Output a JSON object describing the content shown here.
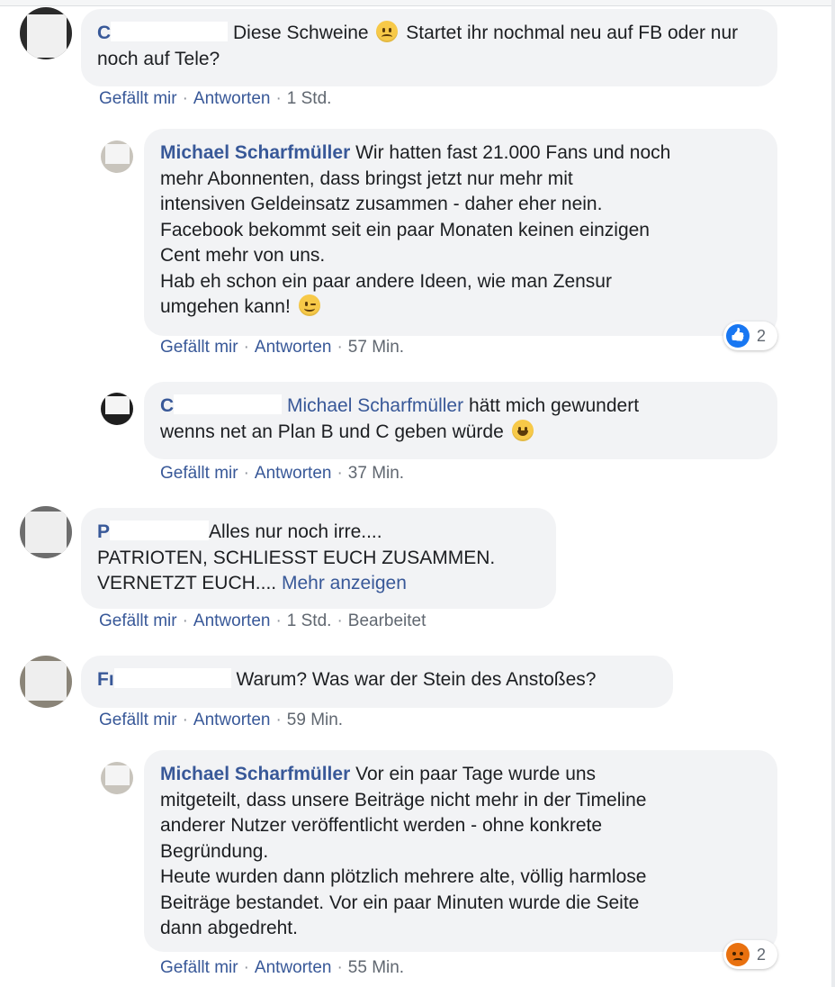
{
  "comments": [
    {
      "author_visible": "C",
      "text_parts": [
        "Diese Schweine",
        "Startet ihr nochmal neu auf FB oder nur noch auf Tele?"
      ],
      "emoji": "angry-face",
      "actions": {
        "like": "Gefällt mir",
        "reply": "Antworten",
        "time": "1 Std."
      }
    },
    {
      "author": "Michael Scharfmüller",
      "text_lines": [
        "Wir hatten fast 21.000 Fans und noch",
        "mehr Abonnenten, dass bringst jetzt nur mehr mit",
        "intensiven Geldeinsatz zusammen - daher eher nein.",
        "Facebook bekommt seit ein paar Monaten keinen einzigen",
        "Cent mehr von uns.",
        "Hab eh schon ein paar andere Ideen, wie man Zensur",
        "umgehen kann!"
      ],
      "emoji": "winking-face",
      "reaction": {
        "icon": "like-icon",
        "count": "2"
      },
      "actions": {
        "like": "Gefällt mir",
        "reply": "Antworten",
        "time": "57 Min."
      }
    },
    {
      "author_visible": "C",
      "mention": "Michael Scharfmüller",
      "text_parts": [
        "hätt mich gewundert",
        "wenns net an Plan B und C geben würde"
      ],
      "emoji": "grinning-face",
      "actions": {
        "like": "Gefällt mir",
        "reply": "Antworten",
        "time": "37 Min."
      }
    },
    {
      "author_visible": "P",
      "text_lines": [
        "Alles nur noch irre....",
        "PATRIOTEN, SCHLIESST EUCH ZUSAMMEN.",
        "VERNETZT EUCH...."
      ],
      "more": "Mehr anzeigen",
      "actions": {
        "like": "Gefällt mir",
        "reply": "Antworten",
        "time": "1 Std.",
        "edited": "Bearbeitet"
      }
    },
    {
      "author_visible": "Fı",
      "text": "Warum? Was war der Stein des Anstoßes?",
      "actions": {
        "like": "Gefällt mir",
        "reply": "Antworten",
        "time": "59 Min."
      }
    },
    {
      "author": "Michael Scharfmüller",
      "text_lines": [
        "Vor ein paar Tage wurde uns",
        "mitgeteilt, dass unsere Beiträge nicht mehr in der Timeline",
        "anderer Nutzer veröffentlicht werden - ohne konkrete",
        "Begründung.",
        "Heute wurden dann plötzlich mehrere alte, völlig harmlose",
        "Beiträge bestandet. Vor ein paar Minuten wurde die Seite",
        "dann abgedreht."
      ],
      "reaction": {
        "icon": "angry-icon",
        "count": "2"
      },
      "actions": {
        "like": "Gefällt mir",
        "reply": "Antworten",
        "time": "55 Min."
      }
    }
  ],
  "colors": {
    "link": "#385898",
    "bubble": "#f2f3f5",
    "meta": "#606770"
  }
}
